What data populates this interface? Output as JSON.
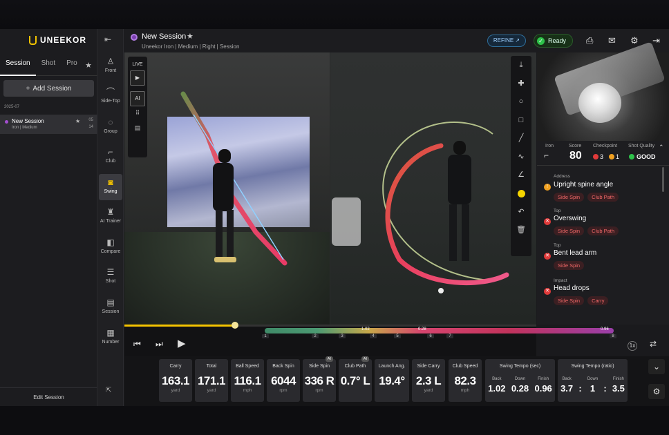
{
  "brand": "UNEEKOR",
  "left_tabs": [
    "Session",
    "Shot",
    "Pro"
  ],
  "add_session": "Add Session",
  "date_group": "2025-07",
  "session": {
    "name": "New Session",
    "sub": "Iron | Medium",
    "c1": "05",
    "c2": "14"
  },
  "edit_session": "Edit Session",
  "nav": [
    "Front",
    "Side-Top",
    "Group",
    "Club",
    "Swing",
    "AI Trainer",
    "Compare",
    "Shot",
    "Session",
    "Number"
  ],
  "header": {
    "title": "New Session",
    "crumbs": "Uneekor   Iron  |  Medium  |  Right  |  Session",
    "refine": "REFINE",
    "ready": "Ready"
  },
  "live": "LIVE",
  "ai": "AI",
  "analysis": {
    "labels": {
      "club": "Iron",
      "score": "Score",
      "checkpoint": "Checkpoint",
      "quality": "Shot Quality"
    },
    "score": "80",
    "cp_red": "3",
    "cp_orange": "1",
    "quality": "GOOD",
    "items": [
      {
        "phase": "Address",
        "title": "Upright spine angle",
        "tags": [
          "Side Spin",
          "Club Path"
        ],
        "level": "warn"
      },
      {
        "phase": "Top",
        "title": "Overswing",
        "tags": [
          "Side Spin",
          "Club Path"
        ],
        "level": "err"
      },
      {
        "phase": "Top",
        "title": "Bent lead arm",
        "tags": [
          "Side Spin"
        ],
        "level": "err"
      },
      {
        "phase": "Impact",
        "title": "Head drops",
        "tags": [
          "Side Spin",
          "Carry"
        ],
        "level": "err"
      }
    ]
  },
  "timeline": {
    "v1": "1.02",
    "v2": "0.28",
    "v3": "0.96",
    "ticks": [
      "1",
      "2",
      "3",
      "4",
      "5",
      "6",
      "7",
      "8"
    ],
    "speed": "1x"
  },
  "stats": [
    {
      "h": "Carry",
      "v": "163.1",
      "u": "yard"
    },
    {
      "h": "Total",
      "v": "171.1",
      "u": "yard"
    },
    {
      "h": "Ball Speed",
      "v": "116.1",
      "u": "mph"
    },
    {
      "h": "Back Spin",
      "v": "6044",
      "u": "rpm"
    },
    {
      "h": "Side Spin",
      "v": "336 R",
      "u": "rpm",
      "badge": "AI"
    },
    {
      "h": "Club Path",
      "v": "0.7° L",
      "u": "",
      "badge": "AI"
    },
    {
      "h": "Launch Ang.",
      "v": "19.4°",
      "u": ""
    },
    {
      "h": "Side Carry",
      "v": "2.3 L",
      "u": "yard"
    },
    {
      "h": "Club Speed",
      "v": "82.3",
      "u": "mph"
    }
  ],
  "tempo_sec": {
    "h": "Swing Tempo (sec)",
    "labels": [
      "Back",
      "Down",
      "Finish"
    ],
    "vals": [
      "1.02",
      "0.28",
      "0.96"
    ]
  },
  "tempo_ratio": {
    "h": "Swing Tempo (ratio)",
    "labels": [
      "Back",
      "Down",
      "Finish"
    ],
    "vals": [
      "3.7",
      "1",
      "3.5"
    ],
    "sep": ":"
  },
  "colors": {
    "accent": "#f5c400",
    "ready": "#2ec24a",
    "tag": "#f06868"
  }
}
